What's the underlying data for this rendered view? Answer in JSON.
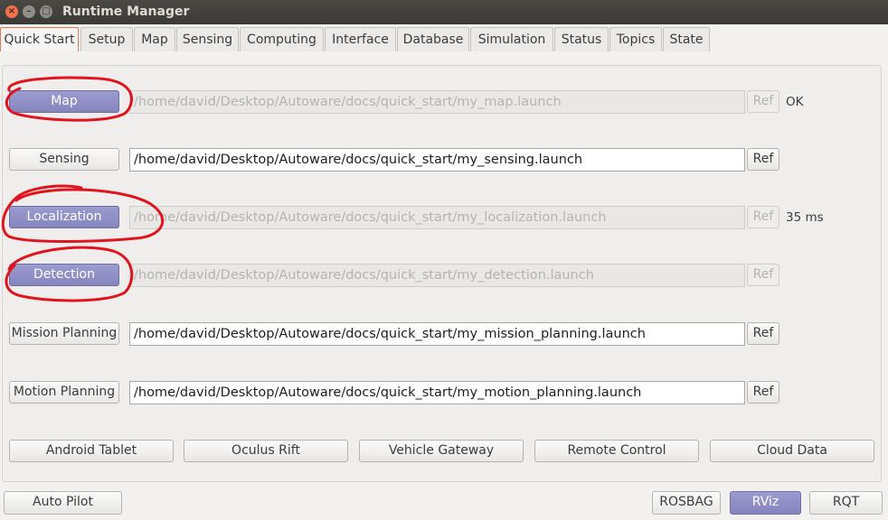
{
  "window": {
    "title": "Runtime Manager",
    "close_glyph": "×",
    "min_glyph": "–",
    "max_glyph": "□"
  },
  "tabs": [
    "Quick Start",
    "Setup",
    "Map",
    "Sensing",
    "Computing",
    "Interface",
    "Database",
    "Simulation",
    "Status",
    "Topics",
    "State"
  ],
  "rows": [
    {
      "button": "Map",
      "path": "/home/david/Desktop/Autoware/docs/quick_start/my_map.launch",
      "ref": "Ref",
      "status": "OK"
    },
    {
      "button": "Sensing",
      "path": "/home/david/Desktop/Autoware/docs/quick_start/my_sensing.launch",
      "ref": "Ref",
      "status": ""
    },
    {
      "button": "Localization",
      "path": "/home/david/Desktop/Autoware/docs/quick_start/my_localization.launch",
      "ref": "Ref",
      "status": "35 ms"
    },
    {
      "button": "Detection",
      "path": "/home/david/Desktop/Autoware/docs/quick_start/my_detection.launch",
      "ref": "Ref",
      "status": ""
    },
    {
      "button": "Mission Planning",
      "path": "/home/david/Desktop/Autoware/docs/quick_start/my_mission_planning.launch",
      "ref": "Ref",
      "status": ""
    },
    {
      "button": "Motion Planning",
      "path": "/home/david/Desktop/Autoware/docs/quick_start/my_motion_planning.launch",
      "ref": "Ref",
      "status": ""
    }
  ],
  "extras": [
    "Android Tablet",
    "Oculus Rift",
    "Vehicle Gateway",
    "Remote Control",
    "Cloud Data"
  ],
  "bottom": {
    "auto_pilot": "Auto Pilot",
    "rosbag": "ROSBAG",
    "rviz": "RViz",
    "rqt": "RQT"
  },
  "colors": {
    "active_button": "#8f8ec6",
    "annotation": "#e0141e",
    "tab_accent": "#e27a4d"
  }
}
